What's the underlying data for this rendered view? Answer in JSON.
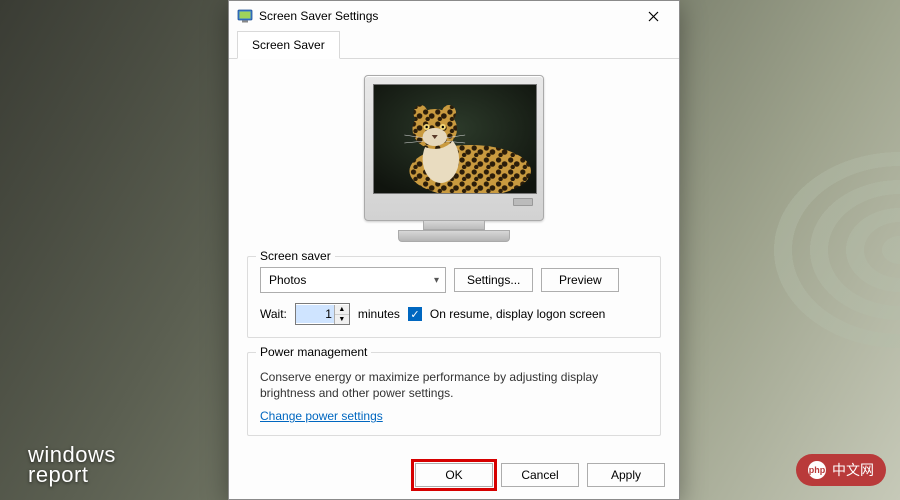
{
  "window": {
    "title": "Screen Saver Settings",
    "tab_label": "Screen Saver"
  },
  "screensaver": {
    "group_label": "Screen saver",
    "selected": "Photos",
    "settings_btn": "Settings...",
    "preview_btn": "Preview",
    "wait_label": "Wait:",
    "wait_value": "1",
    "wait_units": "minutes",
    "resume_checked": true,
    "resume_label": "On resume, display logon screen"
  },
  "power": {
    "group_label": "Power management",
    "desc": "Conserve energy or maximize performance by adjusting display brightness and other power settings.",
    "link": "Change power settings"
  },
  "buttons": {
    "ok": "OK",
    "cancel": "Cancel",
    "apply": "Apply"
  },
  "watermarks": {
    "left_line1": "windows",
    "left_line2": "report",
    "right": "中文网"
  }
}
